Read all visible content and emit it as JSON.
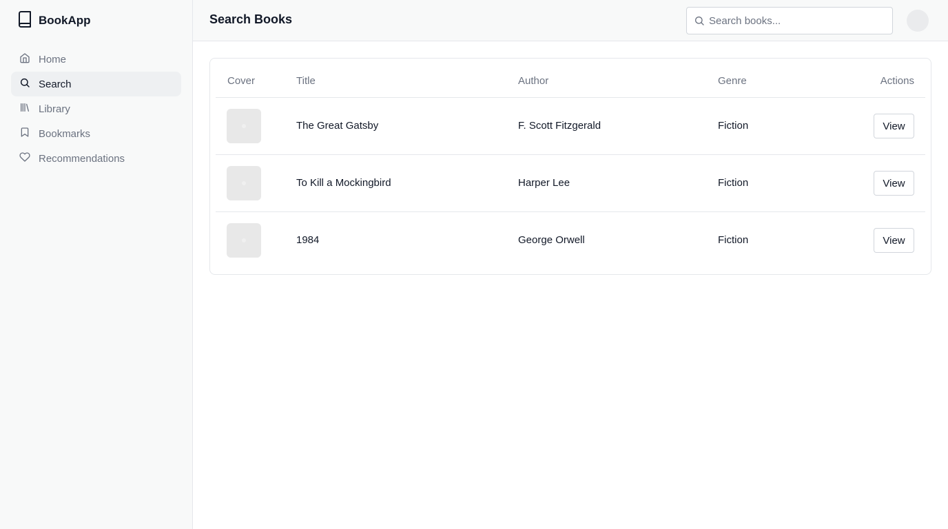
{
  "app": {
    "name": "BookApp"
  },
  "sidebar": {
    "items": [
      {
        "label": "Home",
        "icon": "home-icon",
        "active": false
      },
      {
        "label": "Search",
        "icon": "search-icon",
        "active": true
      },
      {
        "label": "Library",
        "icon": "library-icon",
        "active": false
      },
      {
        "label": "Bookmarks",
        "icon": "bookmark-icon",
        "active": false
      },
      {
        "label": "Recommendations",
        "icon": "heart-icon",
        "active": false
      }
    ]
  },
  "header": {
    "title": "Search Books",
    "search": {
      "placeholder": "Search books...",
      "value": ""
    }
  },
  "table": {
    "columns": [
      "Cover",
      "Title",
      "Author",
      "Genre",
      "Actions"
    ],
    "rows": [
      {
        "title": "The Great Gatsby",
        "author": "F. Scott Fitzgerald",
        "genre": "Fiction",
        "action": "View"
      },
      {
        "title": "To Kill a Mockingbird",
        "author": "Harper Lee",
        "genre": "Fiction",
        "action": "View"
      },
      {
        "title": "1984",
        "author": "George Orwell",
        "genre": "Fiction",
        "action": "View"
      }
    ]
  },
  "colors": {
    "sidebar_bg": "#f8f9f9",
    "active_item_bg": "#eef0f2",
    "border": "#e5e7eb",
    "muted_text": "#6b7280",
    "text": "#111827"
  }
}
